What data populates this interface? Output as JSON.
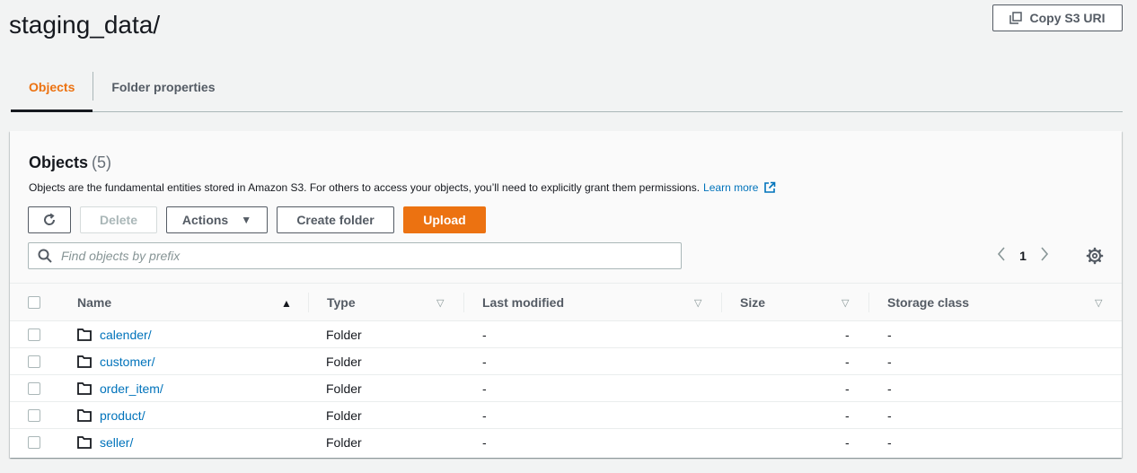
{
  "page": {
    "title": "staging_data/",
    "copy_uri_label": "Copy S3 URI"
  },
  "tabs": [
    {
      "label": "Objects",
      "active": true
    },
    {
      "label": "Folder properties",
      "active": false
    }
  ],
  "objects_panel": {
    "title": "Objects",
    "count": "(5)",
    "description": "Objects are the fundamental entities stored in Amazon S3. For others to access your objects, you’ll need to explicitly grant them permissions.",
    "learn_more": "Learn more",
    "buttons": {
      "delete": "Delete",
      "actions": "Actions",
      "create_folder": "Create folder",
      "upload": "Upload"
    },
    "search_placeholder": "Find objects by prefix",
    "page_number": "1"
  },
  "table": {
    "columns": [
      "Name",
      "Type",
      "Last modified",
      "Size",
      "Storage class"
    ],
    "rows": [
      {
        "name": "calender/",
        "type": "Folder",
        "last_modified": "-",
        "size": "-",
        "storage_class": "-"
      },
      {
        "name": "customer/",
        "type": "Folder",
        "last_modified": "-",
        "size": "-",
        "storage_class": "-"
      },
      {
        "name": "order_item/",
        "type": "Folder",
        "last_modified": "-",
        "size": "-",
        "storage_class": "-"
      },
      {
        "name": "product/",
        "type": "Folder",
        "last_modified": "-",
        "size": "-",
        "storage_class": "-"
      },
      {
        "name": "seller/",
        "type": "Folder",
        "last_modified": "-",
        "size": "-",
        "storage_class": "-"
      }
    ]
  },
  "colors": {
    "accent": "#ec7211",
    "link": "#0073bb",
    "text": "#16191f",
    "muted": "#545b64",
    "background": "#f2f3f3"
  },
  "icons": [
    "copy-icon",
    "external-link-icon",
    "refresh-icon",
    "caret-down-icon",
    "search-icon",
    "chevron-left-icon",
    "chevron-right-icon",
    "gear-icon",
    "sort-asc-icon",
    "sort-icon",
    "folder-icon"
  ]
}
